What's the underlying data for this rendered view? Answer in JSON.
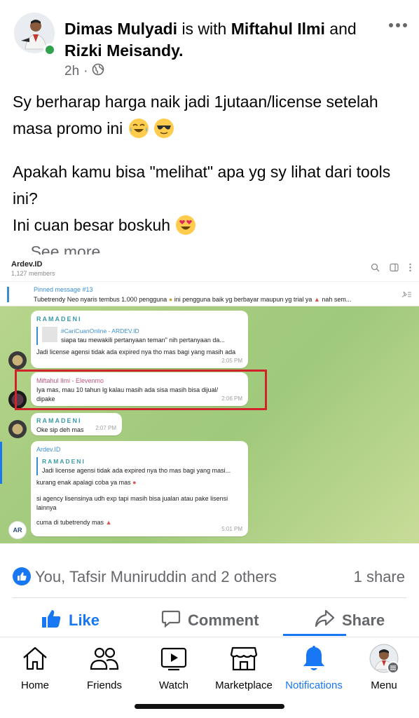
{
  "post": {
    "author": "Dimas Mulyadi",
    "with_text": "is with",
    "tagged_1": "Miftahul Ilmi",
    "and_text": "and",
    "tagged_2": "Rizki Meisandy.",
    "time": "2h",
    "time_sep": "·",
    "privacy_icon": "globe-icon",
    "more_icon": "more-horizontal-icon",
    "text_line1": "Sy berharap harga naik jadi 1jutaan/license setelah masa promo ini",
    "text_line2": "Apakah kamu bisa \"melihat\" apa yg sy lihat dari tools ini?",
    "text_line3": "Ini cuan besar boskuh",
    "see_more_prefix": "...",
    "see_more": "See more"
  },
  "screenshot": {
    "chat_title": "Ardev.ID",
    "members": "1,127 members",
    "pinned_title": "Pinned message #13",
    "pinned_text_a": "Tubetrendy Neo nyaris tembus 1.000 pengguna",
    "pinned_text_b": "ini pengguna baik yg berbayar maupun yg trial ya",
    "pinned_text_c": "nah sem...",
    "messages": [
      {
        "sender": "RAMADENI",
        "reply_name": "#CariCuanOnline - ARDEV.ID",
        "reply_text": "siapa tau mewakili pertanyaan teman\" nih pertanyaan da...",
        "text": "Jadi license agensi tidak ada expired nya tho mas bagi yang masih ada",
        "time": "2:05 PM"
      },
      {
        "sender": "Miftahul Ilmi - Elevenmo",
        "text": "Iya mas, mau 10 tahun lg kalau masih ada sisa masih bisa dijual/ dipake",
        "time": "2:06 PM"
      },
      {
        "sender": "RAMADENI",
        "text": "Oke sip deh mas",
        "time": "2:07 PM"
      },
      {
        "sender": "Ardev.ID",
        "reply_name": "RAMADENI",
        "reply_text": "Jadi license agensi tidak ada expired nya tho mas bagi yang masi...",
        "text1": "kurang enak apalagi coba ya mas",
        "text2": "si agency lisensinya udh exp tapi masih bisa jualan atau pake lisensi lainnya",
        "text3": "cuma di tubetrendy mas",
        "avatar_text": "AR",
        "time": "5:01 PM"
      }
    ]
  },
  "reactions": {
    "summary": "You, Tafsir Muniruddin and 2 others",
    "shares": "1 share"
  },
  "actions": {
    "like": "Like",
    "comment": "Comment",
    "share": "Share"
  },
  "tabs": [
    {
      "label": "Home",
      "icon": "home-icon"
    },
    {
      "label": "Friends",
      "icon": "friends-icon"
    },
    {
      "label": "Watch",
      "icon": "watch-icon"
    },
    {
      "label": "Marketplace",
      "icon": "marketplace-icon"
    },
    {
      "label": "Notifications",
      "icon": "bell-icon",
      "active": true
    },
    {
      "label": "Menu",
      "icon": "menu-avatar-icon"
    }
  ],
  "colors": {
    "brand": "#1877f2",
    "highlight_box": "#d1232a",
    "online": "#31a24c"
  }
}
